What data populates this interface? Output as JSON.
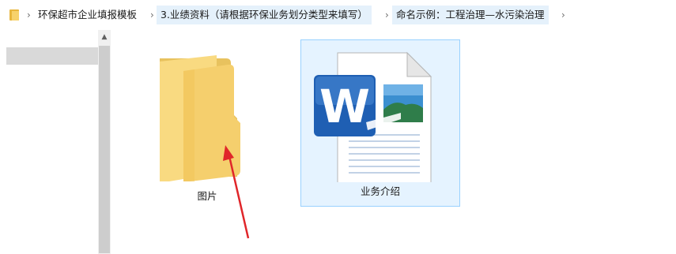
{
  "breadcrumb": {
    "items": [
      {
        "label": "环保超市企业填报模板"
      },
      {
        "label": "3.业绩资料（请根据环保业务划分类型来填写）"
      },
      {
        "label": "命名示例：工程治理—水污染治理"
      }
    ]
  },
  "files": [
    {
      "name": "图片",
      "type": "folder"
    },
    {
      "name": "业务介绍",
      "type": "word-document"
    }
  ],
  "colors": {
    "selection_bg": "#e5f3ff",
    "selection_border": "#99d1ff",
    "annotation_arrow": "#e0262a"
  }
}
